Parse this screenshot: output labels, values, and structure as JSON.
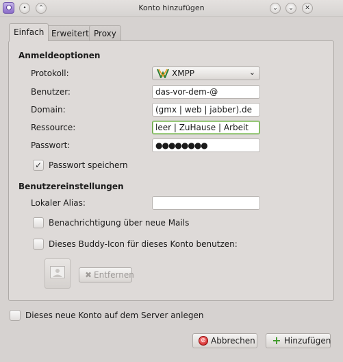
{
  "window": {
    "title": "Konto hinzufügen"
  },
  "tabs": [
    {
      "label": "Einfach"
    },
    {
      "label": "Erweitert"
    },
    {
      "label": "Proxy"
    }
  ],
  "login": {
    "section_title": "Anmeldeoptionen",
    "protocol_label": "Protokoll:",
    "protocol_value": "XMPP",
    "user_label": "Benutzer:",
    "user_value": "das-vor-dem-@",
    "domain_label": "Domain:",
    "domain_value": "(gmx | web | jabber).de",
    "resource_label": "Ressource:",
    "resource_value": "leer | ZuHause | Arbeit",
    "password_label": "Passwort:",
    "password_value": "●●●●●●●●",
    "remember_label": "Passwort speichern",
    "remember_checked": true
  },
  "user_settings": {
    "section_title": "Benutzereinstellungen",
    "alias_label": "Lokaler Alias:",
    "alias_value": "",
    "notify_label": "Benachrichtigung über neue Mails",
    "notify_checked": false,
    "buddy_icon_label": "Dieses Buddy-Icon für dieses Konto benutzen:",
    "buddy_icon_checked": false,
    "remove_label": "Entfernen"
  },
  "footer": {
    "create_on_server_label": "Dieses neue Konto auf dem Server anlegen",
    "create_on_server_checked": false,
    "cancel_label": "Abbrechen",
    "add_label": "Hinzufügen"
  }
}
